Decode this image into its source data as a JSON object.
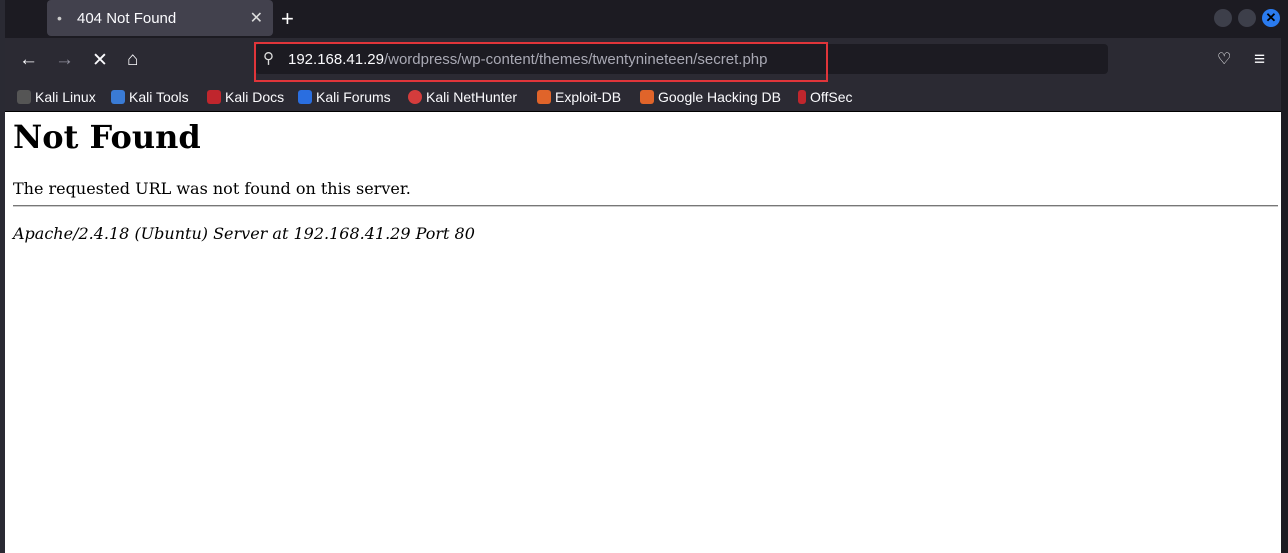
{
  "tab": {
    "title": "404 Not Found"
  },
  "url": {
    "host": "192.168.41.29",
    "path": "/wordpress/wp-content/themes/twentynineteen/secret.php"
  },
  "bookmarks": [
    {
      "label": "Kali Linux",
      "color": "#1c1b22"
    },
    {
      "label": "Kali Tools",
      "color": "#3a7bd5"
    },
    {
      "label": "Kali Docs",
      "color": "#c0262d"
    },
    {
      "label": "Kali Forums",
      "color": "#2a6ee0"
    },
    {
      "label": "Kali NetHunter",
      "color": "#d43c3c"
    },
    {
      "label": "Exploit-DB",
      "color": "#e0642a"
    },
    {
      "label": "Google Hacking DB",
      "color": "#e0642a"
    },
    {
      "label": "OffSec",
      "color": "#c0262d"
    }
  ],
  "page": {
    "heading": "Not Found",
    "message": "The requested URL was not found on this server.",
    "address": "Apache/2.4.18 (Ubuntu) Server at 192.168.41.29 Port 80"
  }
}
